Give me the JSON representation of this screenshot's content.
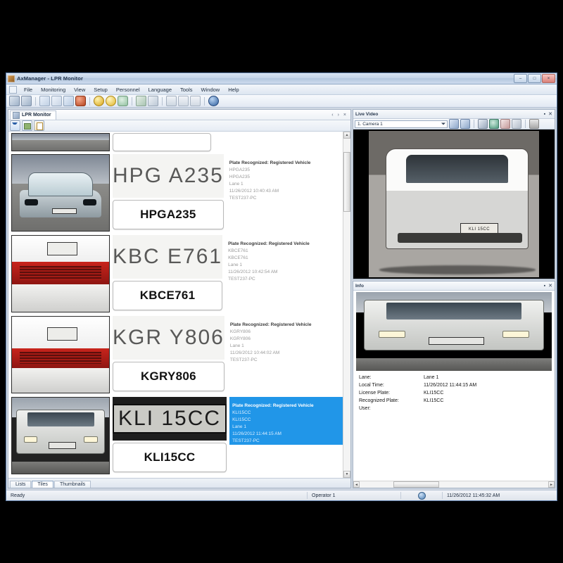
{
  "window": {
    "title": "AxManager - LPR Monitor",
    "min_label": "–",
    "max_label": "□",
    "close_label": "×"
  },
  "menu": {
    "items": [
      "File",
      "Monitoring",
      "View",
      "Setup",
      "Personnel",
      "Language",
      "Tools",
      "Window",
      "Help"
    ]
  },
  "toolbar": {
    "icons": [
      "export-icon",
      "import-icon",
      "refresh-icon",
      "filter-icon",
      "report-icon",
      "stop-icon",
      "record-on-icon",
      "record-off-icon",
      "camera-icon",
      "car-in-icon",
      "car-out-icon",
      "list-icon",
      "tile-icon",
      "thumbnail-icon",
      "help-icon"
    ]
  },
  "document": {
    "tab_label": "LPR Monitor",
    "nav_prev": "‹",
    "nav_next": "›",
    "nav_close": "×",
    "toolbar_icons": [
      "filter-funnel-icon",
      "export-excel-icon",
      "report-icon"
    ]
  },
  "records": [
    {
      "plate_image_text": "HPG A235",
      "plate_text": "HPGA235",
      "status": "Plate Recognized: Registered Vehicle",
      "plate": "HPGA235",
      "recognized": "HPGA235",
      "lane": "Lane 1",
      "time": "11/26/2012 10:40:43 AM",
      "host": "TEST237-PC",
      "selected": false,
      "vehicle": "sedan"
    },
    {
      "plate_image_text": "KBC E761",
      "plate_text": "KBCE761",
      "status": "Plate Recognized: Registered Vehicle",
      "plate": "KBCE761",
      "recognized": "KBCE761",
      "lane": "Lane 1",
      "time": "11/26/2012 10:42:54 AM",
      "host": "TEST237-PC",
      "selected": false,
      "vehicle": "red"
    },
    {
      "plate_image_text": "KGR Y806",
      "plate_text": "KGRY806",
      "status": "Plate Recognized: Registered Vehicle",
      "plate": "KGRY806",
      "recognized": "KGRY806",
      "lane": "Lane 1",
      "time": "11/26/2012 10:44:02 AM",
      "host": "TEST237-PC",
      "selected": false,
      "vehicle": "red2"
    },
    {
      "plate_image_text": "KLI 15CC",
      "plate_text": "KLI15CC",
      "status": "Plate Recognized: Registered Vehicle",
      "plate": "KLI15CC",
      "recognized": "KLI15CC",
      "lane": "Lane 1",
      "time": "11/26/2012 11:44:15 AM",
      "host": "TEST237-PC",
      "selected": true,
      "vehicle": "truck"
    }
  ],
  "view_tabs": {
    "items": [
      "Lists",
      "Tiles",
      "Thumbnails"
    ],
    "active": "Tiles"
  },
  "live_video": {
    "title": "Live Video",
    "pin_label": "▪",
    "close_label": "✕",
    "camera_selected": "1. Camera 1",
    "buttons": [
      "audio-on-icon",
      "audio-off-icon",
      "snapshot-icon",
      "ptz-icon",
      "zoom-in-icon",
      "zoom-out-icon",
      "archive-icon"
    ],
    "overlay_plate": "KLI 15CC"
  },
  "info": {
    "title": "Info",
    "pin_label": "▪",
    "close_label": "✕",
    "rows": [
      {
        "key": "Lane:",
        "value": "Lane 1"
      },
      {
        "key": "Local Time:",
        "value": "11/26/2012 11:44:15 AM"
      },
      {
        "key": "License Plate:",
        "value": "KLI15CC"
      },
      {
        "key": "Recognized Plate:",
        "value": "KLI15CC"
      },
      {
        "key": "User:",
        "value": ""
      }
    ],
    "overlay_plate": "KLI 15CC"
  },
  "statusbar": {
    "message": "Ready",
    "operator": "Operator 1",
    "sync_icon": "sync-icon",
    "timestamp": "11/26/2012 11:45:32 AM"
  },
  "colors": {
    "selection": "#2196e8",
    "title_accent": "#b2c6de",
    "panel_bg": "#eef1f5"
  }
}
